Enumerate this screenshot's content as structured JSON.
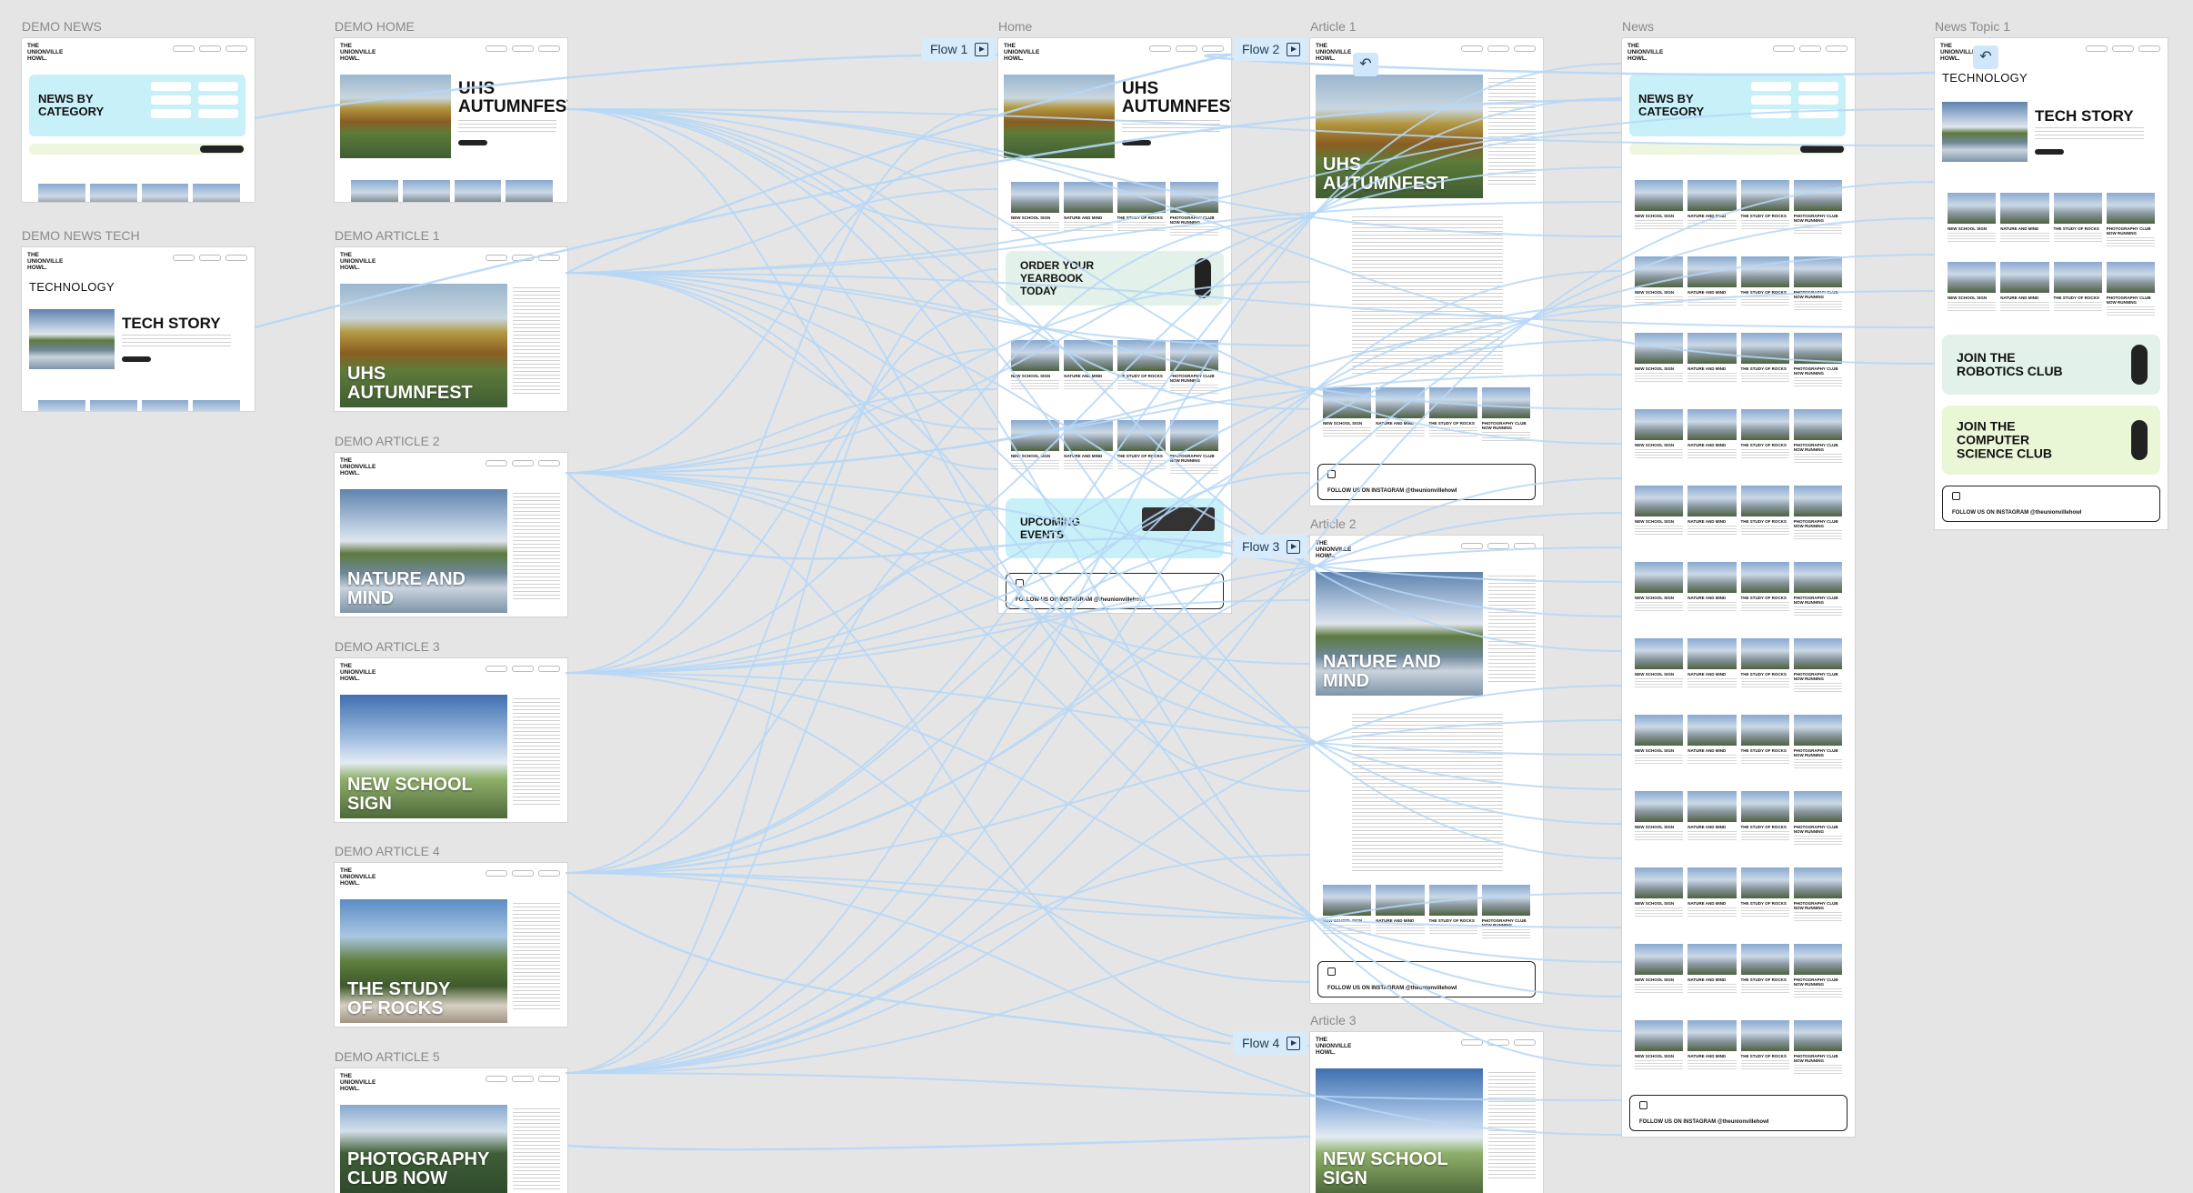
{
  "frames": {
    "demo_news": "DEMO NEWS",
    "demo_home": "DEMO HOME",
    "demo_news_tech": "DEMO NEWS TECH",
    "demo_article_1": "DEMO ARTICLE 1",
    "demo_article_2": "DEMO ARTICLE 2",
    "demo_article_3": "DEMO ARTICLE 3",
    "demo_article_4": "DEMO ARTICLE 4",
    "demo_article_5": "DEMO ARTICLE 5",
    "home": "Home",
    "article_1": "Article 1",
    "article_2": "Article 2",
    "article_3": "Article 3",
    "news": "News",
    "news_topic_1": "News Topic 1"
  },
  "flows": [
    "Flow 1",
    "Flow 2",
    "Flow 3",
    "Flow 4"
  ],
  "brand": "THE\nUNIONVILLE\nHOWL.",
  "headlines": {
    "autumnfest": "UHS\nAUTUMNFEST",
    "nature": "NATURE AND\nMIND",
    "sign": "NEW SCHOOL\nSIGN",
    "rocks": "THE STUDY\nOF ROCKS",
    "photo_club": "PHOTOGRAPHY\nCLUB NOW",
    "tech_story": "TECH STORY",
    "technology": "TECHNOLOGY",
    "news_by_category": "NEWS BY\nCATEGORY"
  },
  "cards": {
    "order_yearbook": "ORDER YOUR\nYEARBOOK\nTODAY",
    "upcoming_events": "UPCOMING\nEVENTS",
    "robotics": "JOIN THE\nROBOTICS CLUB",
    "cs_club": "JOIN THE\nCOMPUTER\nSCIENCE CLUB",
    "follow_instagram": "FOLLOW US ON INSTAGRAM  @theunionvillehowl"
  },
  "thumb_captions": [
    "NEW SCHOOL SIGN",
    "NATURE AND MIND",
    "THE STUDY OF ROCKS",
    "PHOTOGRAPHY CLUB NOW RUNNING"
  ],
  "icons": {
    "flow": "play-icon",
    "back": "back-arrow-icon",
    "instagram": "instagram-icon"
  },
  "colors": {
    "canvas": "#e5e5e5",
    "wire": "#b6d7f7",
    "cyan": "#c8f0f8",
    "lime": "#eaf7d6"
  }
}
